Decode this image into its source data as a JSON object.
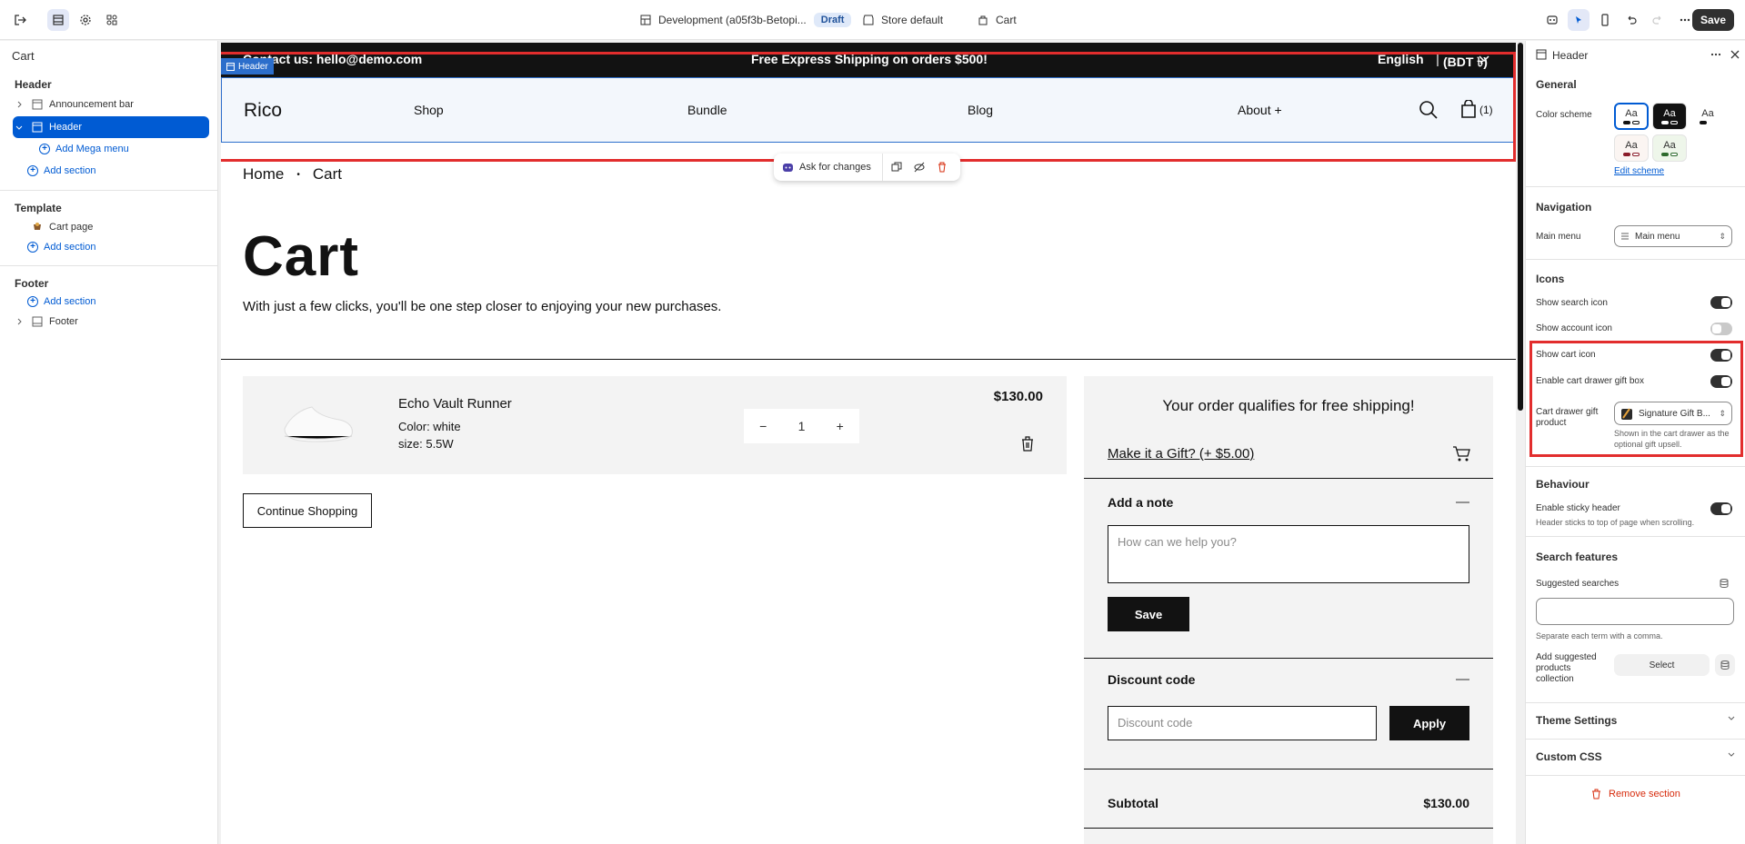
{
  "topbar": {
    "theme_name": "Development (a05f3b-Betopi...",
    "theme_badge": "Draft",
    "store": "Store default",
    "page": "Cart",
    "save_label": "Save"
  },
  "left_sidebar": {
    "title": "Cart",
    "header_group": "Header",
    "announcement_bar": "Announcement bar",
    "header_item": "Header",
    "add_mega_menu": "Add Mega menu",
    "add_section_1": "Add section",
    "template_group": "Template",
    "cart_page": "Cart page",
    "add_section_2": "Add section",
    "footer_group": "Footer",
    "add_section_3": "Add section",
    "footer_item": "Footer"
  },
  "preview": {
    "announcement": {
      "contact": "Contact us: hello@demo.com",
      "shipping": "Free Express Shipping on orders $500!",
      "language": "English",
      "currency": "(BDT ৳)"
    },
    "header_tag": "Header",
    "logo": "Rico",
    "nav": [
      "Shop",
      "Bundle",
      "Blog",
      "About +"
    ],
    "cart_count": "(1)",
    "ask_changes": "Ask for changes",
    "breadcrumb": [
      "Home",
      "Cart"
    ],
    "title": "Cart",
    "subtitle": "With just a few clicks, you'll be one step closer to enjoying your new purchases.",
    "item": {
      "name": "Echo Vault Runner",
      "color": "Color: white",
      "size": "size: 5.5W",
      "qty": "1",
      "price": "$130.00"
    },
    "continue": "Continue Shopping",
    "free_shipping": "Your order qualifies for free shipping!",
    "gift_link": "Make it a Gift? (+ $5.00)",
    "note_title": "Add a note",
    "note_placeholder": "How can we help you?",
    "note_save": "Save",
    "discount_title": "Discount code",
    "discount_placeholder": "Discount code",
    "apply": "Apply",
    "subtotal_label": "Subtotal",
    "subtotal_value": "$130.00"
  },
  "right_sidebar": {
    "title": "Header",
    "general": "General",
    "color_scheme": "Color scheme",
    "swatch_text": "Aa",
    "edit_scheme": "Edit scheme",
    "navigation": "Navigation",
    "main_menu_label": "Main menu",
    "main_menu_value": "Main menu",
    "icons": "Icons",
    "show_search": "Show search icon",
    "show_account": "Show account icon",
    "show_cart": "Show cart icon",
    "enable_gift": "Enable cart drawer gift box",
    "gift_product_label": "Cart drawer gift product",
    "gift_product_value": "Signature Gift B...",
    "gift_help": "Shown in the cart drawer as the optional gift upsell.",
    "behaviour": "Behaviour",
    "sticky": "Enable sticky header",
    "sticky_help": "Header sticks to top of page when scrolling.",
    "search_features": "Search features",
    "suggested_searches": "Suggested searches",
    "searches_help": "Separate each term with a comma.",
    "add_suggested": "Add suggested products collection",
    "select": "Select",
    "theme_settings": "Theme Settings",
    "custom_css": "Custom CSS",
    "remove_section": "Remove section"
  },
  "colors": {
    "accent": "#005bd3",
    "highlight": "#e22d2d",
    "dark": "#121212"
  }
}
